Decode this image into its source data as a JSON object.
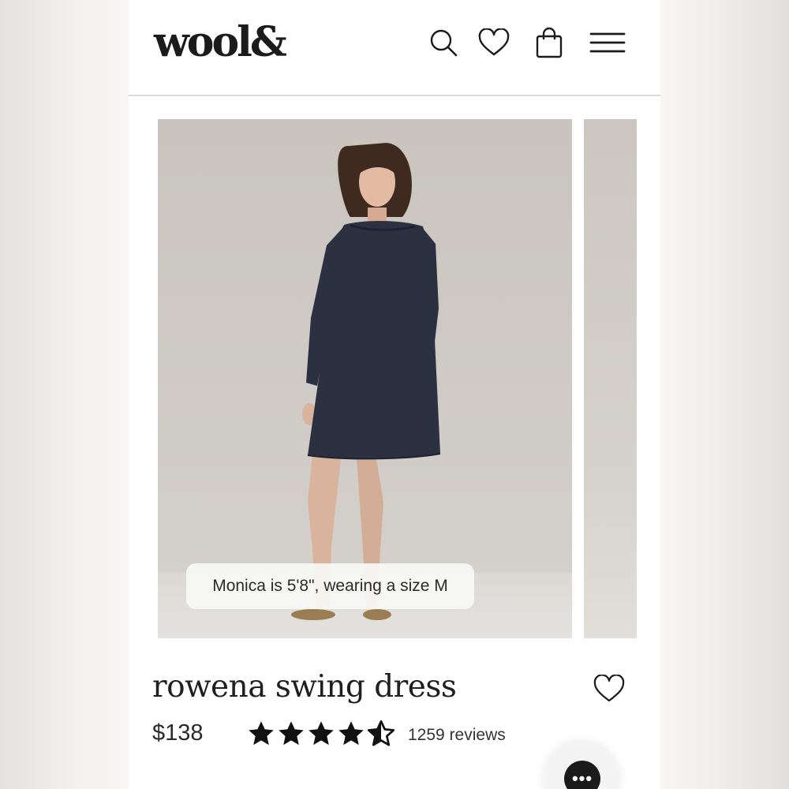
{
  "header": {
    "logo": "wool&",
    "icons": [
      "search-icon",
      "heart-icon",
      "shopping-bag-icon",
      "menu-icon"
    ]
  },
  "gallery": {
    "caption": "Monica is 5'8\", wearing a size M",
    "dress_color": "#2b3140"
  },
  "product": {
    "title": "rowena swing dress",
    "price": "$138",
    "rating": 4.5,
    "rating_max": 5,
    "reviews": "1259 reviews"
  },
  "chat": {
    "icon": "chat-bubble-icon",
    "glyph": "•••"
  },
  "colors": {
    "text": "#1f1f1f",
    "background": "#ffffff",
    "photo_backdrop": "#cdc8c2"
  }
}
